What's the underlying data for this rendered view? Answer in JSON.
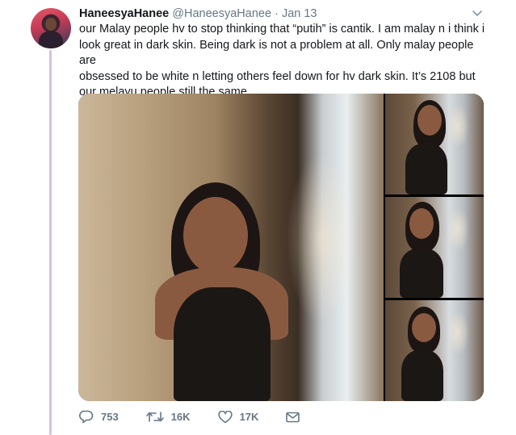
{
  "tweet": {
    "display_name": "HaneesyaHanee",
    "handle": "@HaneesyaHanee",
    "separator": "·",
    "date": "Jan 13",
    "text": "our Malay people hv to stop thinking that “putih” is cantik. I am malay n i think i\nlook great in dark skin. Being dark is not a problem at all. Only malay people are\nobsessed to be white n letting others feel down for hv dark skin. It’s 2108 but\nour melayu people still the same.",
    "media_count": 4,
    "actions": {
      "replies": "753",
      "retweets": "16K",
      "likes": "17K"
    }
  },
  "icons": {
    "caret": "chevron-down-icon",
    "reply": "reply-icon",
    "retweet": "retweet-icon",
    "like": "heart-icon",
    "dm": "envelope-icon"
  },
  "colors": {
    "text": "#14171a",
    "secondary": "#657786",
    "thread_line": "#d4c2e8"
  }
}
